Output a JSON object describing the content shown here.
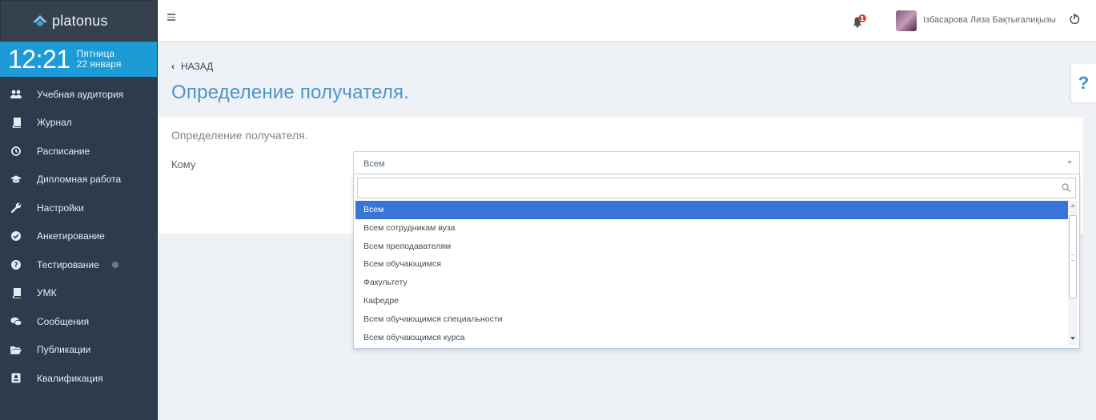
{
  "app": {
    "logo_text": "platonus"
  },
  "clock": {
    "time": "12:21",
    "weekday": "Пятница",
    "date": "22 января"
  },
  "sidebar": {
    "items": [
      {
        "label": "Учебная аудитория",
        "icon": "users-icon"
      },
      {
        "label": "Журнал",
        "icon": "book-icon"
      },
      {
        "label": "Расписание",
        "icon": "clock-icon"
      },
      {
        "label": "Дипломная работа",
        "icon": "graduation-cap-icon"
      },
      {
        "label": "Настройки",
        "icon": "wrench-icon"
      },
      {
        "label": "Анкетирование",
        "icon": "check-circle-icon"
      },
      {
        "label": "Тестирование",
        "icon": "question-circle-icon"
      },
      {
        "label": "УМК",
        "icon": "book-icon"
      },
      {
        "label": "Сообщения",
        "icon": "comments-icon"
      },
      {
        "label": "Публикации",
        "icon": "folder-open-icon"
      },
      {
        "label": "Квалификация",
        "icon": "id-card-icon"
      }
    ]
  },
  "header": {
    "user_name": "Ізбасарова Лиза Бақтығалиқызы",
    "notification_count": "1"
  },
  "page": {
    "back_label": "НАЗАД",
    "title": "Определение получателя.",
    "help_symbol": "?"
  },
  "panel": {
    "title": "Определение получателя.",
    "field_label": "Кому"
  },
  "select": {
    "value": "Всем",
    "search_value": "",
    "options": [
      "Всем",
      "Всем сотрудникам вуза",
      "Всем преподавателям",
      "Всем обучающимся",
      "Факультету",
      "Кафедре",
      "Всем обучающимся специальности",
      "Всем обучающимся курса"
    ],
    "selected_index": 0
  },
  "colors": {
    "sidebar_bg": "#2e3b4d",
    "clock_bg": "#1d9bd7",
    "title_blue": "#4d95c8",
    "selected_option": "#3875d7"
  }
}
